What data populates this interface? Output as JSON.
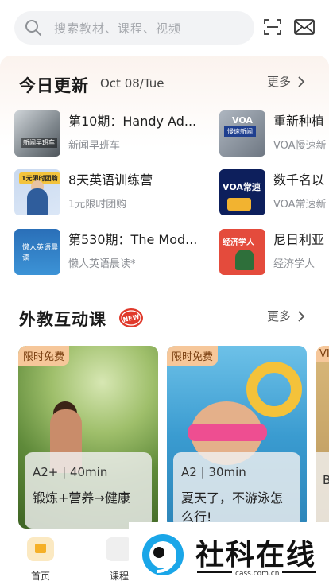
{
  "search": {
    "placeholder": "搜索教材、课程、视频"
  },
  "icons": {
    "search": "search-icon",
    "scan": "scan-icon",
    "mail": "mail-icon"
  },
  "today": {
    "title": "今日更新",
    "date": "Oct 08/Tue",
    "more": "更多",
    "items": [
      {
        "title": "第10期：Handy Ad...",
        "sub": "新闻早班车",
        "thumb_text": "新闻早班车"
      },
      {
        "title": "重新种植",
        "sub": "VOA慢速新",
        "thumb_text": "VOA 慢速新闻"
      },
      {
        "title": "8天英语训练营",
        "sub": "1元限时团购",
        "thumb_text": "1元限时团购"
      },
      {
        "title": "数千名以",
        "sub": "VOA常速新",
        "thumb_text": "VOA常速"
      },
      {
        "title": "第530期：The Mod...",
        "sub": "懒人英语晨读*",
        "thumb_text": "懒人英语晨读"
      },
      {
        "title": "尼日利亚",
        "sub": "经济学人",
        "thumb_text": "经济学人"
      }
    ]
  },
  "foreign": {
    "title": "外教互动课",
    "badge": "NEW",
    "more": "更多",
    "cards": [
      {
        "tag": "限时免费",
        "level": "A2+ | 40min",
        "title": "锻炼+营养→健康"
      },
      {
        "tag": "限时免费",
        "level": "A2 | 30min",
        "title": "夏天了，不游泳怎么行!"
      },
      {
        "tag": "VI",
        "level": "B"
      }
    ]
  },
  "tabs": [
    {
      "label": "首页"
    },
    {
      "label": "课程"
    }
  ],
  "watermark": {
    "text": "社科在线",
    "url": "cass.com.cn"
  },
  "colors": {
    "accent": "#f5b028",
    "free_tag": "#f6c79a",
    "new_badge": "#e0392b"
  }
}
